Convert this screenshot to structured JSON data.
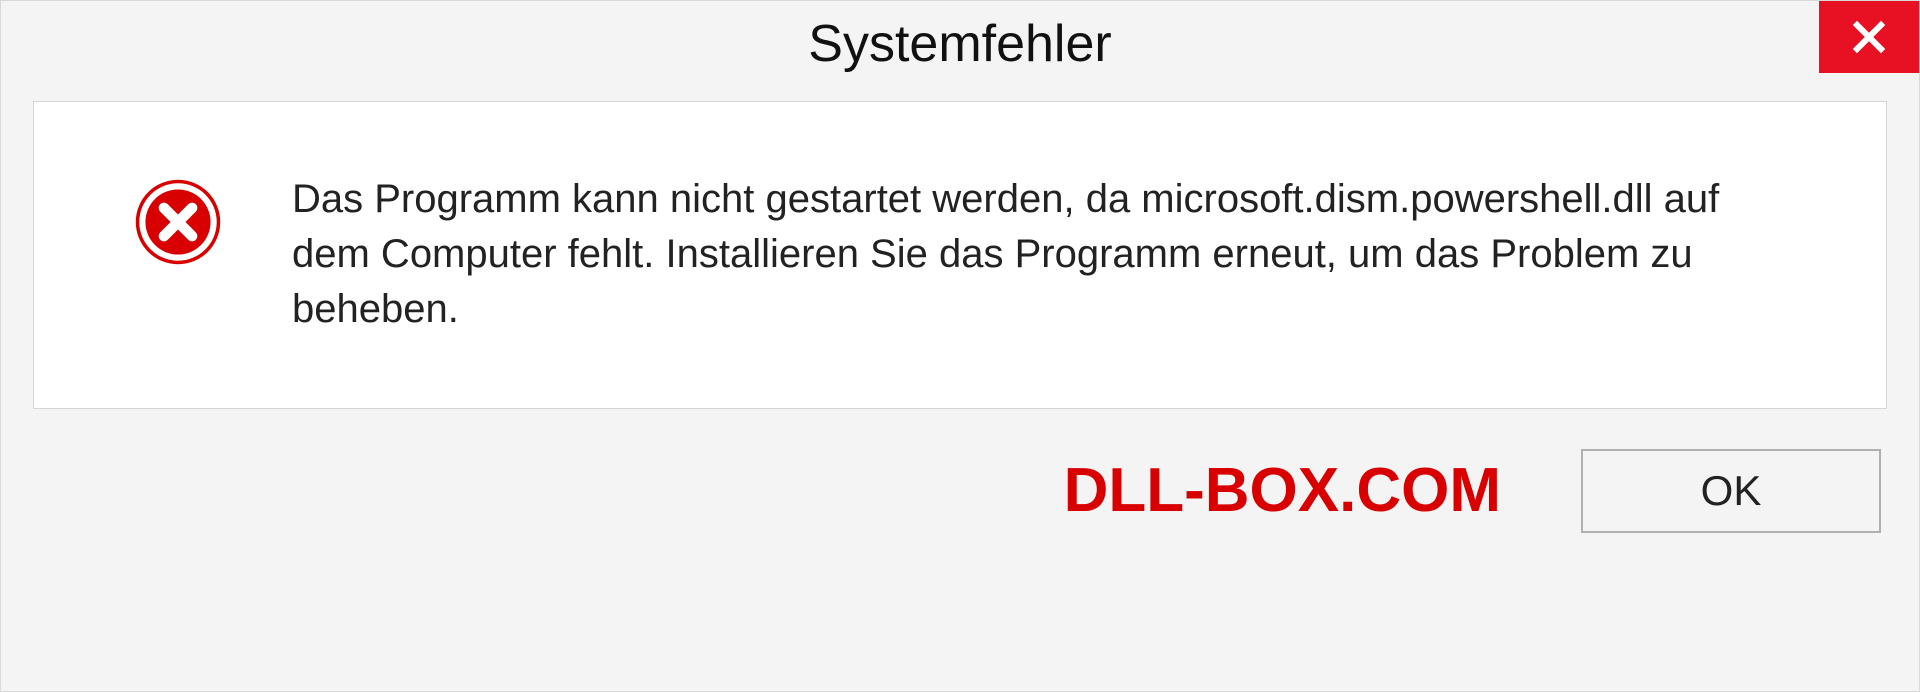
{
  "dialog": {
    "title": "Systemfehler",
    "message": "Das Programm kann nicht gestartet werden, da microsoft.dism.powershell.dll auf dem Computer fehlt. Installieren Sie das Programm erneut, um das Problem zu beheben.",
    "okLabel": "OK"
  },
  "watermark": "DLL-BOX.COM",
  "colors": {
    "closeButton": "#e81123",
    "errorIcon": "#d80000",
    "watermark": "#d80000"
  }
}
